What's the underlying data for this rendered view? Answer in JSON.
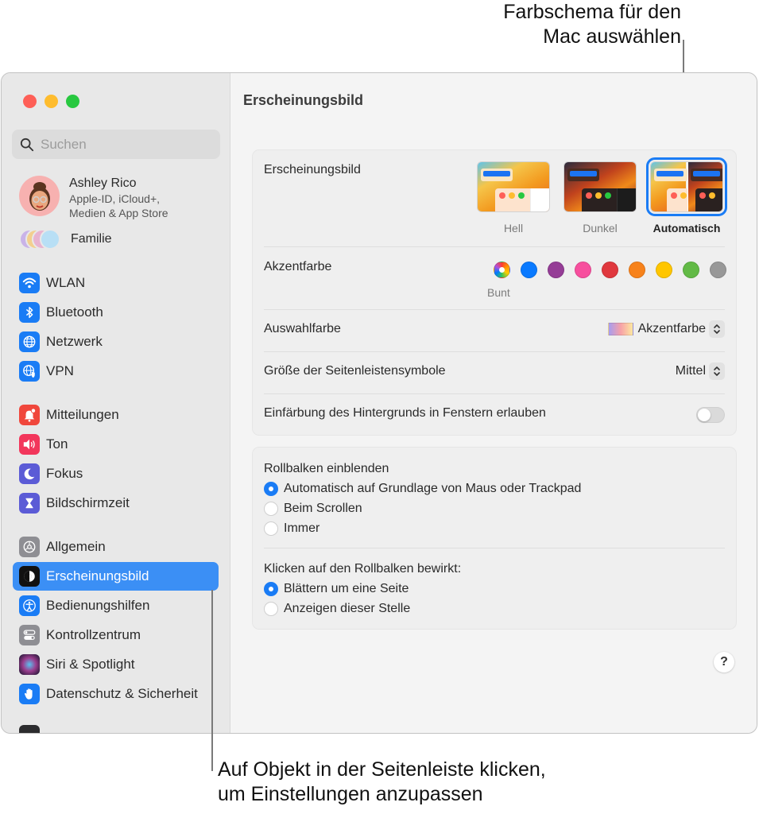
{
  "callouts": {
    "top": [
      "Farbschema für den",
      "Mac auswählen"
    ],
    "bottom": [
      "Auf Objekt in der Seitenleiste klicken,",
      "um Einstellungen anzupassen"
    ]
  },
  "sidebar": {
    "search_placeholder": "Suchen",
    "profile": {
      "name": "Ashley Rico",
      "subtitle_line1": "Apple-ID, iCloud+,",
      "subtitle_line2": "Medien & App Store"
    },
    "family_label": "Familie",
    "items": [
      {
        "label": "WLAN",
        "icon": "wifi-icon",
        "color": "#1a7cf5"
      },
      {
        "label": "Bluetooth",
        "icon": "bluetooth-icon",
        "color": "#1a7cf5"
      },
      {
        "label": "Netzwerk",
        "icon": "globe-icon",
        "color": "#1a7cf5"
      },
      {
        "label": "VPN",
        "icon": "vpn-globe-shield-icon",
        "color": "#1a7cf5"
      },
      {
        "label": "Mitteilungen",
        "icon": "bell-badge-icon",
        "color": "#f0473c"
      },
      {
        "label": "Ton",
        "icon": "speaker-icon",
        "color": "#f2365b"
      },
      {
        "label": "Fokus",
        "icon": "moon-icon",
        "color": "#5b5bd6"
      },
      {
        "label": "Bildschirmzeit",
        "icon": "hourglass-icon",
        "color": "#5b5bd6"
      },
      {
        "label": "Allgemein",
        "icon": "gear-icon",
        "color": "#8e8e93"
      },
      {
        "label": "Erscheinungsbild",
        "icon": "appearance-icon",
        "color": "#111111",
        "active": true
      },
      {
        "label": "Bedienungshilfen",
        "icon": "accessibility-icon",
        "color": "#1a7cf5"
      },
      {
        "label": "Kontrollzentrum",
        "icon": "toggles-icon",
        "color": "#8e8e93"
      },
      {
        "label": "Siri & Spotlight",
        "icon": "siri-icon",
        "color": "#9b3d8e"
      },
      {
        "label": "Datenschutz & Sicherheit",
        "icon": "hand-icon",
        "color": "#1a7cf5"
      }
    ]
  },
  "main": {
    "title": "Erscheinungsbild",
    "appearance": {
      "label": "Erscheinungsbild",
      "options": [
        {
          "label": "Hell",
          "selected": false
        },
        {
          "label": "Dunkel",
          "selected": false
        },
        {
          "label": "Automatisch",
          "selected": true
        }
      ]
    },
    "accent": {
      "label": "Akzentfarbe",
      "selected_caption": "Bunt",
      "colors": [
        {
          "name": "Bunt",
          "hex": "multicolor"
        },
        {
          "name": "Blau",
          "hex": "#0a7aff"
        },
        {
          "name": "Lila",
          "hex": "#953d96"
        },
        {
          "name": "Pink",
          "hex": "#f74f9e"
        },
        {
          "name": "Rot",
          "hex": "#e0383e"
        },
        {
          "name": "Orange",
          "hex": "#f7821b"
        },
        {
          "name": "Gelb",
          "hex": "#ffc600"
        },
        {
          "name": "Grün",
          "hex": "#62ba46"
        },
        {
          "name": "Graphit",
          "hex": "#989898"
        }
      ]
    },
    "highlight": {
      "label": "Auswahlfarbe",
      "value": "Akzentfarbe"
    },
    "sidebar_icon_size": {
      "label": "Größe der Seitenleistensymbole",
      "value": "Mittel"
    },
    "wallpaper_tinting": {
      "label": "Einfärbung des Hintergrunds in Fenstern erlauben",
      "enabled": false
    },
    "scrollbars": {
      "show_label": "Rollbalken einblenden",
      "show_options": [
        {
          "label": "Automatisch auf Grundlage von Maus oder Trackpad",
          "selected": true
        },
        {
          "label": "Beim Scrollen",
          "selected": false
        },
        {
          "label": "Immer",
          "selected": false
        }
      ],
      "click_label": "Klicken auf den Rollbalken bewirkt:",
      "click_options": [
        {
          "label": "Blättern um eine Seite",
          "selected": true
        },
        {
          "label": "Anzeigen dieser Stelle",
          "selected": false
        }
      ]
    },
    "help_label": "?"
  }
}
